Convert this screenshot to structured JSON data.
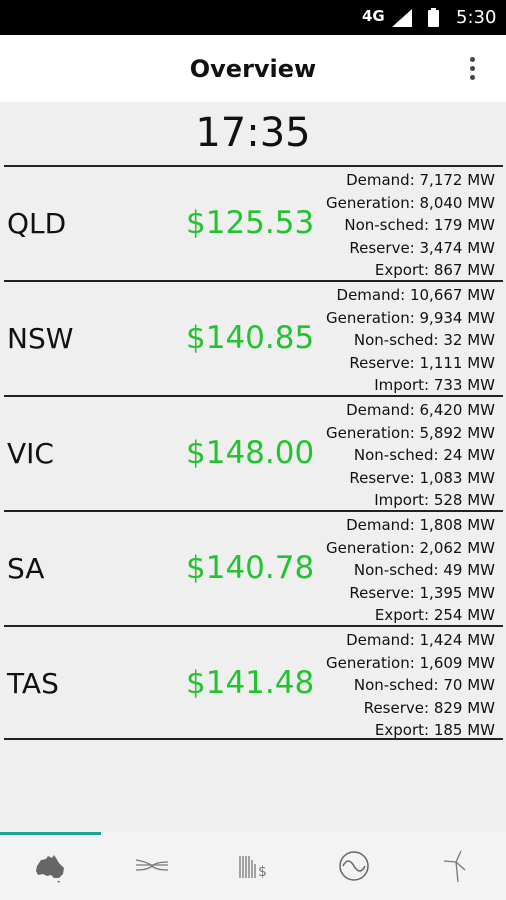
{
  "status_bar": {
    "network": "4G",
    "time": "5:30"
  },
  "app_bar": {
    "title": "Overview"
  },
  "clock": "17:35",
  "regions": [
    {
      "name": "QLD",
      "price": "$125.53",
      "stats": [
        "Demand: 7,172 MW",
        "Generation: 8,040 MW",
        "Non-sched: 179 MW",
        "Reserve: 3,474 MW",
        "Export: 867 MW"
      ]
    },
    {
      "name": "NSW",
      "price": "$140.85",
      "stats": [
        "Demand: 10,667 MW",
        "Generation: 9,934 MW",
        "Non-sched: 32 MW",
        "Reserve: 1,111 MW",
        "Import: 733 MW"
      ]
    },
    {
      "name": "VIC",
      "price": "$148.00",
      "stats": [
        "Demand: 6,420 MW",
        "Generation: 5,892 MW",
        "Non-sched: 24 MW",
        "Reserve: 1,083 MW",
        "Import: 528 MW"
      ]
    },
    {
      "name": "SA",
      "price": "$140.78",
      "stats": [
        "Demand: 1,808 MW",
        "Generation: 2,062 MW",
        "Non-sched: 49 MW",
        "Reserve: 1,395 MW",
        "Export: 254 MW"
      ]
    },
    {
      "name": "TAS",
      "price": "$141.48",
      "stats": [
        "Demand: 1,424 MW",
        "Generation: 1,609 MW",
        "Non-sched: 70 MW",
        "Reserve: 829 MW",
        "Export: 185 MW"
      ]
    }
  ],
  "tabs": [
    {
      "icon": "australia-map-icon",
      "active": true
    },
    {
      "icon": "interconnector-icon",
      "active": false
    },
    {
      "icon": "price-bars-icon",
      "active": false
    },
    {
      "icon": "frequency-wave-icon",
      "active": false
    },
    {
      "icon": "wind-turbine-icon",
      "active": false
    }
  ],
  "colors": {
    "price": "#22c32e",
    "accent": "#1aa38f",
    "status_bar": "#000000"
  }
}
